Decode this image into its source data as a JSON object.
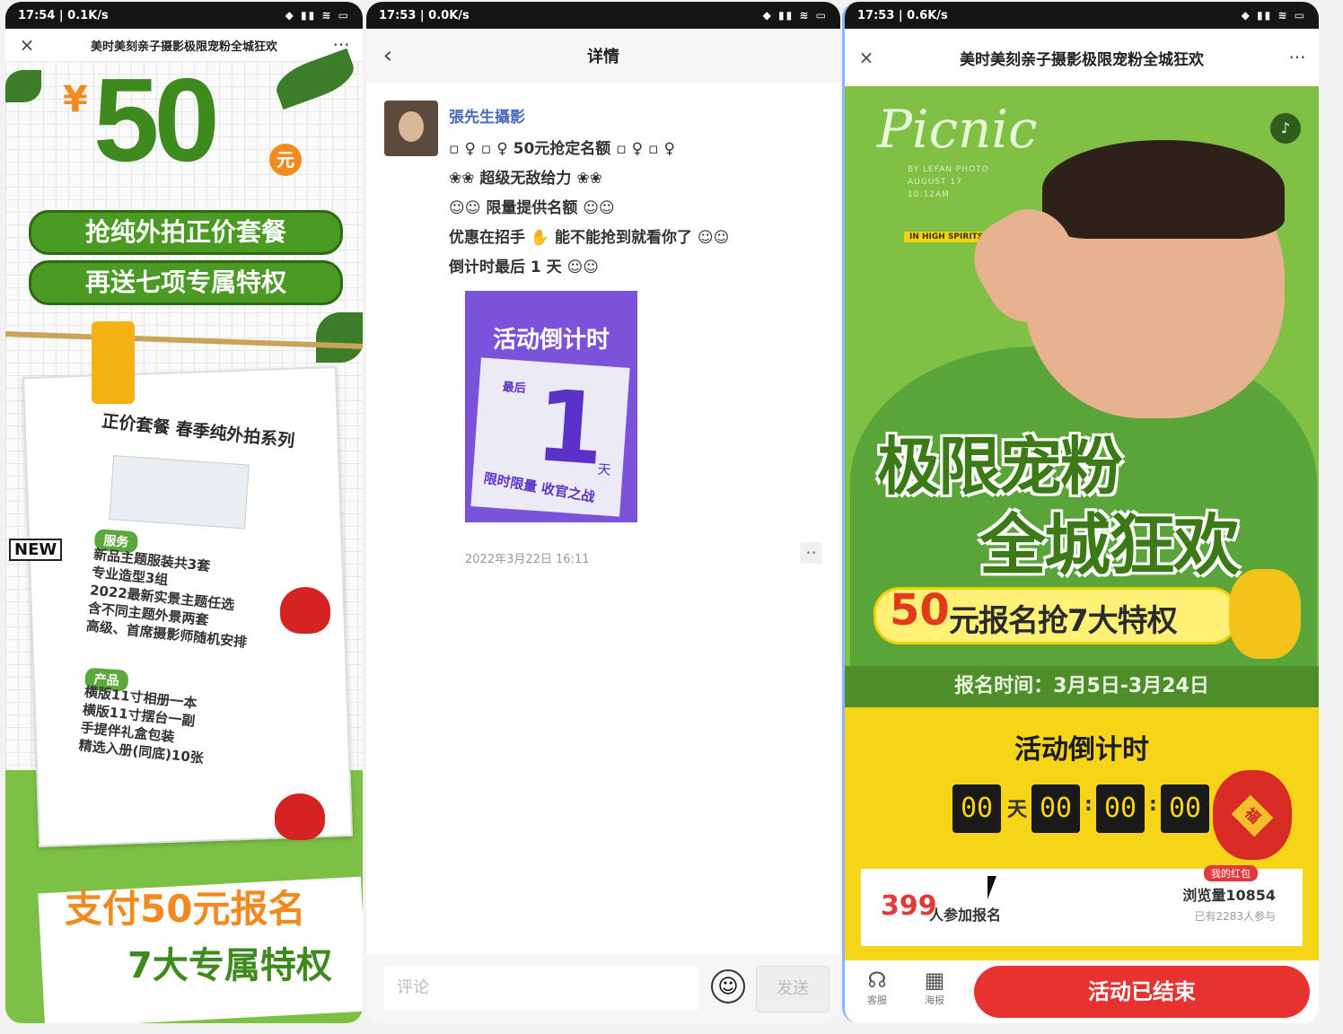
{
  "phone1": {
    "status": {
      "left": "17:54 | 0.1K/s",
      "right": "◆ ▮▮ ≋ ▭"
    },
    "nav": {
      "close": "×",
      "title": "美时美刻亲子摄影极限宠粉全城狂欢",
      "more": "···"
    },
    "price_symbol": "¥",
    "price": "50",
    "price_unit": "元",
    "pill1": "抢纯外拍正价套餐",
    "pill2": "再送七项专属特权",
    "card_title": "正价套餐 春季纯外拍系列",
    "new_badge": "NEW",
    "service_tag": "服务",
    "service_lines": [
      "新品主题服装共3套",
      "专业造型3组",
      "2022最新实景主题任选",
      "含不同主题外景两套",
      "高级、首席摄影师随机安排"
    ],
    "product_tag": "产品",
    "product_lines": [
      "横版11寸相册一本",
      "横版11寸摆台一副",
      "手提伴礼盒包装",
      "精选入册(同底)10张"
    ],
    "pay_line1": "支付50元报名",
    "pay_line2": "7大专属特权"
  },
  "phone2": {
    "status": {
      "left": "17:53 | 0.0K/s",
      "right": "◆ ▮▮ ≋ ▭"
    },
    "nav": {
      "back": "‹",
      "title": "详情"
    },
    "author": "張先生攝影",
    "lines": [
      "▫ ♀ ▫ ♀ 50元抢定名额 ▫ ♀ ▫ ♀",
      "❀❀ 超级无敌给力 ❀❀",
      "☺☺ 限量提供名额 ☺☺",
      "优惠在招手 ✋ 能不能抢到就看你了 ☺☺",
      "倒计时最后 1 天 ☺☺"
    ],
    "countdown_image": {
      "title": "活动倒计时",
      "top_small": "最后",
      "number": "1",
      "unit": "天",
      "foot": "限时限量 收官之战"
    },
    "time": "2022年3月22日 16:11",
    "more": "··",
    "comment_placeholder": "评论",
    "emoji": "☺",
    "send": "发送"
  },
  "phone3": {
    "status": {
      "left": "17:53 | 0.6K/s",
      "right": "◆ ▮▮ ≋ ▭"
    },
    "nav": {
      "close": "×",
      "title": "美时美刻亲子摄影极限宠粉全城狂欢",
      "more": "···"
    },
    "picnic": "Picnic",
    "meta": [
      "BY LEFAN PHOTO",
      "AUGUST 17",
      "10:12AM"
    ],
    "hi_tag": "IN HIGH SPIRITS",
    "hero_line1": "极限宠粉",
    "hero_line2": "全城狂欢",
    "promo_num": "50",
    "promo_text": "元报名抢7大特权",
    "signup_time": "报名时间：3月5日-3月24日",
    "countdown_title": "活动倒计时",
    "countdown": {
      "days": "00",
      "hours": "00",
      "minutes": "00",
      "seconds": "00",
      "day_unit": "天",
      "sep": ":"
    },
    "bag_char": "福",
    "red_tag": "我的红包",
    "join_count": "399",
    "join_label": "人参加报名",
    "views": "浏览量10854",
    "joined": "已有2283人参与",
    "service_label": "客服",
    "poster_label": "海报",
    "end_button": "活动已结束"
  }
}
